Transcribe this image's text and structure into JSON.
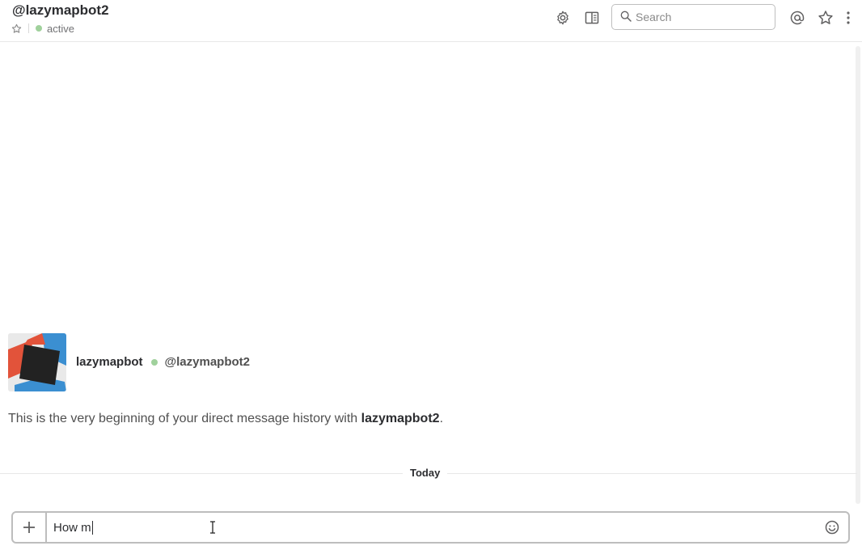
{
  "header": {
    "title": "@lazymapbot2",
    "status": "active",
    "search_placeholder": "Search",
    "icons": [
      "gear-icon",
      "details-panel-icon",
      "search-icon",
      "mentions-icon",
      "star-icon",
      "more-icon"
    ]
  },
  "intro": {
    "name": "lazymapbot",
    "handle": "@lazymapbot2",
    "text_prefix": "This is the very beginning of your direct message history with",
    "text_bold": "lazymapbot2",
    "text_suffix": "."
  },
  "divider": {
    "label": "Today"
  },
  "composer": {
    "value": "How m"
  },
  "colors": {
    "presence": "#a0d19c",
    "avatar_red": "#e2533a",
    "avatar_blue": "#3b8fd1",
    "avatar_dark": "#222222"
  }
}
